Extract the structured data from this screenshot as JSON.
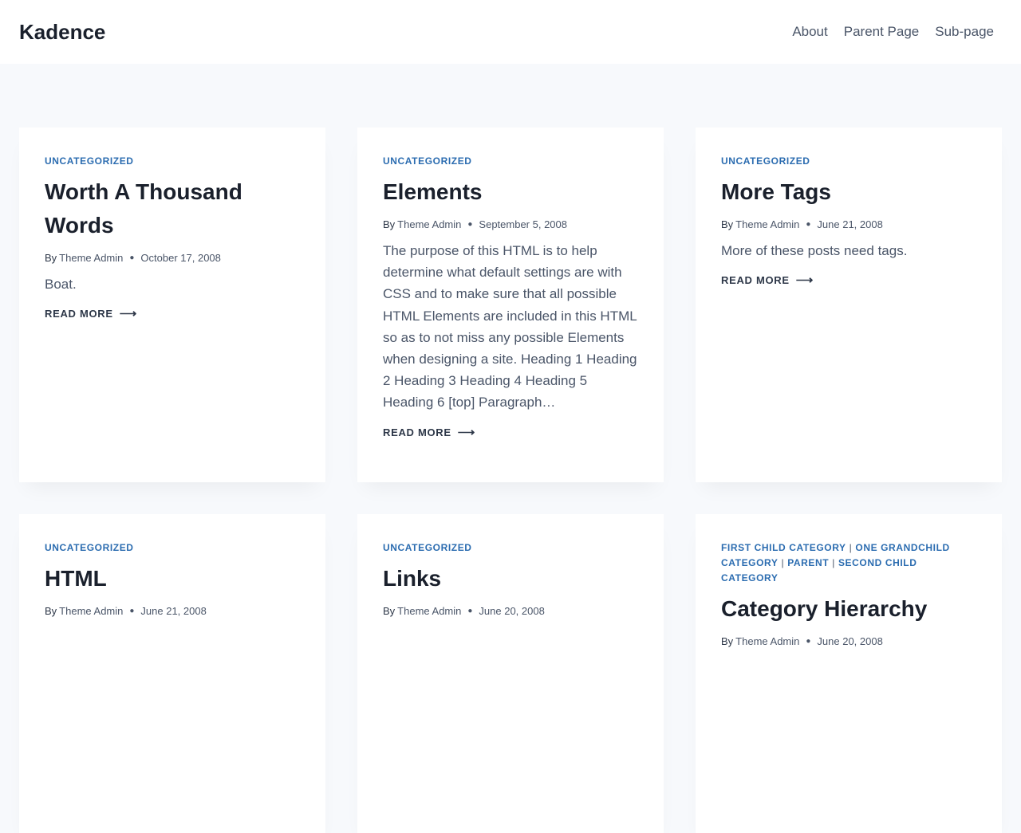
{
  "site": {
    "title": "Kadence",
    "nav": [
      "About",
      "Parent Page",
      "Sub-page"
    ]
  },
  "posts": [
    {
      "categories": [
        "Uncategorized"
      ],
      "title": "Worth A Thousand Words",
      "by": "By",
      "author": "Theme Admin",
      "date": "October 17, 2008",
      "excerpt": "Boat.",
      "read_more": "Read More"
    },
    {
      "categories": [
        "Uncategorized"
      ],
      "title": "Elements",
      "by": "By",
      "author": "Theme Admin",
      "date": "September 5, 2008",
      "excerpt": "The purpose of this HTML is to help determine what default settings are with CSS and to make sure that all possible HTML Elements are included in this HTML so as to not miss any possible Elements when designing a site. Heading 1 Heading 2 Heading 3 Heading 4 Heading 5 Heading 6 [top] Paragraph…",
      "read_more": "Read More"
    },
    {
      "categories": [
        "Uncategorized"
      ],
      "title": "More Tags",
      "by": "By",
      "author": "Theme Admin",
      "date": "June 21, 2008",
      "excerpt": "More of these posts need tags.",
      "read_more": "Read More"
    },
    {
      "categories": [
        "Uncategorized"
      ],
      "title": "HTML",
      "by": "By",
      "author": "Theme Admin",
      "date": "June 21, 2008"
    },
    {
      "categories": [
        "Uncategorized"
      ],
      "title": "Links",
      "by": "By",
      "author": "Theme Admin",
      "date": "June 20, 2008"
    },
    {
      "categories": [
        "First Child Category",
        "One Grandchild Category",
        "Parent",
        "Second Child Category"
      ],
      "title": "Category Hierarchy",
      "by": "By",
      "author": "Theme Admin",
      "date": "June 20, 2008"
    }
  ],
  "icons": {
    "read_more_arrow": "long-arrow-right-icon",
    "meta_separator": "bullet-dot-icon"
  },
  "colors": {
    "accent": "#2b6cb0",
    "background": "#f7f9fc",
    "card": "#ffffff",
    "text": "#1a202c"
  }
}
